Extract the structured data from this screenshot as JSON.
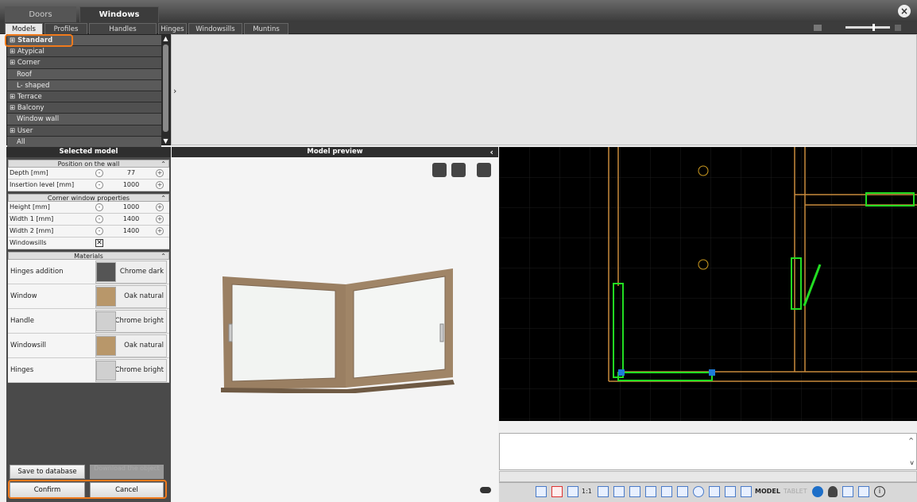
{
  "top_tabs": [
    "Doors",
    "Windows"
  ],
  "sub_tabs": [
    "Models",
    "Profiles",
    "Handles",
    "Hinges",
    "Windowsills",
    "Muntins"
  ],
  "tree": [
    {
      "label": "Standard",
      "prefix": "⊞",
      "level": 0,
      "selected": true
    },
    {
      "label": "Atypical",
      "prefix": "⊞",
      "level": 0
    },
    {
      "label": "Corner",
      "prefix": "⊞",
      "level": 0
    },
    {
      "label": "Roof",
      "prefix": "",
      "level": 1
    },
    {
      "label": "L- shaped",
      "prefix": "",
      "level": 1
    },
    {
      "label": "Terrace",
      "prefix": "⊞",
      "level": 0
    },
    {
      "label": "Balcony",
      "prefix": "⊞",
      "level": 0
    },
    {
      "label": "Window wall",
      "prefix": "",
      "level": 1
    },
    {
      "label": "User",
      "prefix": "⊞",
      "level": 0
    },
    {
      "label": "All",
      "prefix": "",
      "level": 1
    }
  ],
  "selected_model": {
    "title": "Selected model",
    "position_section": "Position on the wall",
    "depth_label": "Depth [mm]",
    "depth_value": "77",
    "insertion_label": "Insertion level [mm]",
    "insertion_value": "1000",
    "corner_section": "Corner window properties",
    "height_label": "Height [mm]",
    "height_value": "1000",
    "width1_label": "Width 1 [mm]",
    "width1_value": "1400",
    "width2_label": "Width 2 [mm]",
    "width2_value": "1400",
    "windowsills_label": "Windowsills",
    "windowsills_checked": true,
    "materials_section": "Materials",
    "materials": [
      {
        "label": "Hinges addition",
        "material": "Chrome dark",
        "swatch": "#555555"
      },
      {
        "label": "Window",
        "material": "Oak natural",
        "swatch": "#b8976a"
      },
      {
        "label": "Handle",
        "material": "Chrome bright",
        "swatch": "#d0d0d0"
      },
      {
        "label": "Windowsill",
        "material": "Oak natural",
        "swatch": "#b8976a"
      },
      {
        "label": "Hinges",
        "material": "Chrome bright",
        "swatch": "#d0d0d0"
      }
    ]
  },
  "buttons": {
    "save": "Save to database",
    "download": "Download the object",
    "confirm": "Confirm",
    "cancel": "Cancel"
  },
  "preview": {
    "title": "Model preview"
  },
  "statusbar": {
    "scale_label": "1:1",
    "model_label": "MODEL",
    "tablet_label": "TABLET"
  },
  "colors": {
    "accent_orange": "#f07a1c",
    "cad_bg": "#000000",
    "cad_green": "#22dd22",
    "cad_wall": "#c88a3c"
  }
}
